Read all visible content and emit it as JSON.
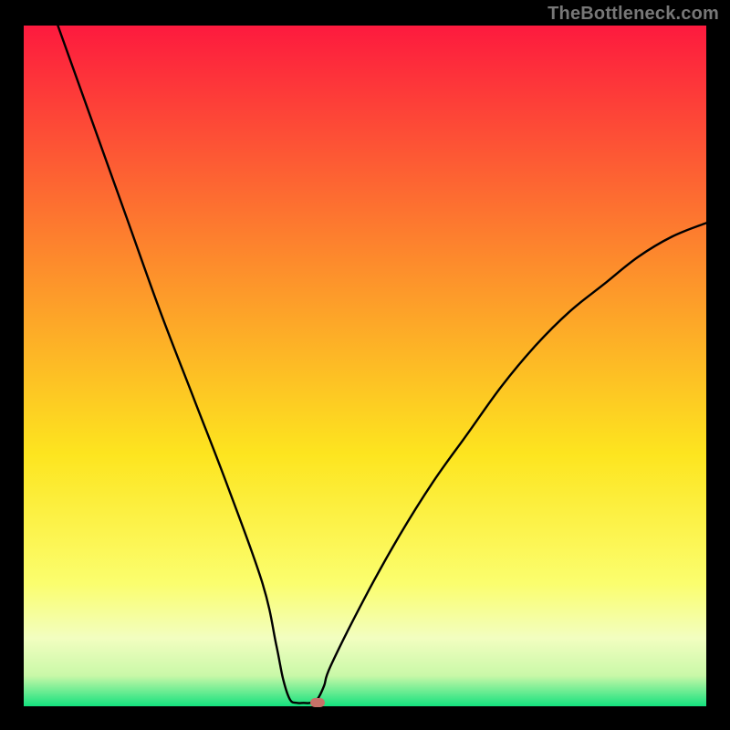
{
  "watermark": "TheBottleneck.com",
  "colors": {
    "frame": "#000000",
    "gradient_top": "#fd1a3e",
    "gradient_mid1": "#fd8c2c",
    "gradient_mid2": "#fde51f",
    "gradient_mid3": "#fafe83",
    "gradient_bottom": "#14e17e",
    "curve": "#000000",
    "marker": "#c77168"
  },
  "chart_data": {
    "type": "line",
    "title": "",
    "xlabel": "",
    "ylabel": "",
    "xlim": [
      0,
      100
    ],
    "ylim": [
      0,
      100
    ],
    "series": [
      {
        "name": "bottleneck-curve",
        "x": [
          5,
          10,
          15,
          20,
          25,
          30,
          35,
          37,
          38,
          39,
          40,
          41,
          42,
          43,
          44,
          45,
          50,
          55,
          60,
          65,
          70,
          75,
          80,
          85,
          90,
          95,
          100
        ],
        "y": [
          100,
          86,
          72,
          58,
          45,
          32,
          18,
          9,
          4,
          1,
          0.5,
          0.5,
          0.5,
          1,
          3,
          6,
          16,
          25,
          33,
          40,
          47,
          53,
          58,
          62,
          66,
          69,
          71
        ]
      }
    ],
    "flat_region_x": [
      39,
      43
    ],
    "marker": {
      "x": 43,
      "y": 0.5
    },
    "gradient_stops": [
      {
        "pos": 0.0,
        "color": "#fd1a3e"
      },
      {
        "pos": 0.35,
        "color": "#fd8c2c"
      },
      {
        "pos": 0.63,
        "color": "#fde51f"
      },
      {
        "pos": 0.82,
        "color": "#fbfe6e"
      },
      {
        "pos": 0.9,
        "color": "#f2fec0"
      },
      {
        "pos": 0.955,
        "color": "#c9f8a8"
      },
      {
        "pos": 1.0,
        "color": "#14e17e"
      }
    ]
  }
}
